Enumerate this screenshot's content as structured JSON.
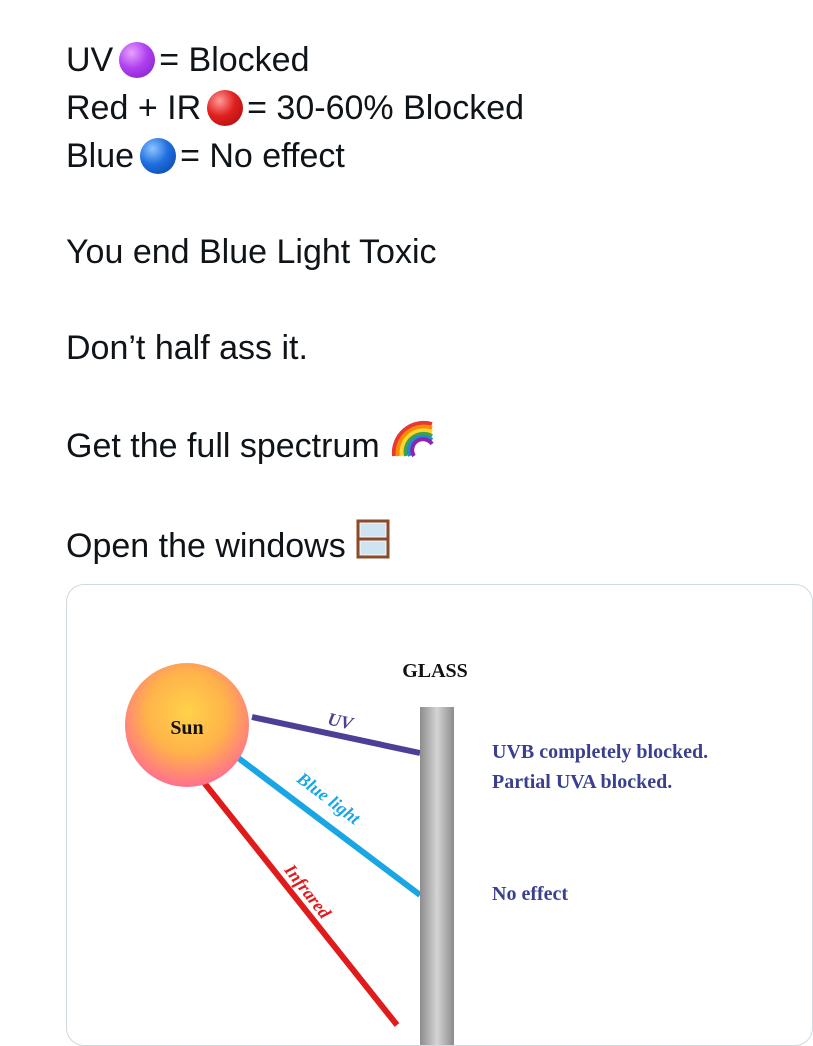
{
  "tweet": {
    "lines": [
      {
        "label": "UV",
        "icon": "purple-circle-icon",
        "result": "= Blocked"
      },
      {
        "label": "Red + IR",
        "icon": "red-circle-icon",
        "result": "= 30-60% Blocked"
      },
      {
        "label": "Blue",
        "icon": "blue-circle-icon",
        "result": "= No effect"
      }
    ],
    "line_blue_light": "You end Blue Light Toxic",
    "line_half_ass": "Don’t half ass it.",
    "line_spectrum": "Get the full spectrum",
    "spectrum_icon": "rainbow-icon",
    "line_windows": "Open the windows",
    "windows_icon": "window-icon"
  },
  "diagram": {
    "glass_label": "GLASS",
    "sun_label": "Sun",
    "rays": [
      {
        "label": "UV",
        "color": "#4b3f96"
      },
      {
        "label": "Blue light",
        "color": "#1aa6e4"
      },
      {
        "label": "Infrared",
        "color": "#e01b1b"
      }
    ],
    "uv_note_line1": "UVB completely blocked.",
    "uv_note_line2": "Partial UVA blocked.",
    "blue_note": "No effect",
    "note_color": "#3a3f8f"
  }
}
